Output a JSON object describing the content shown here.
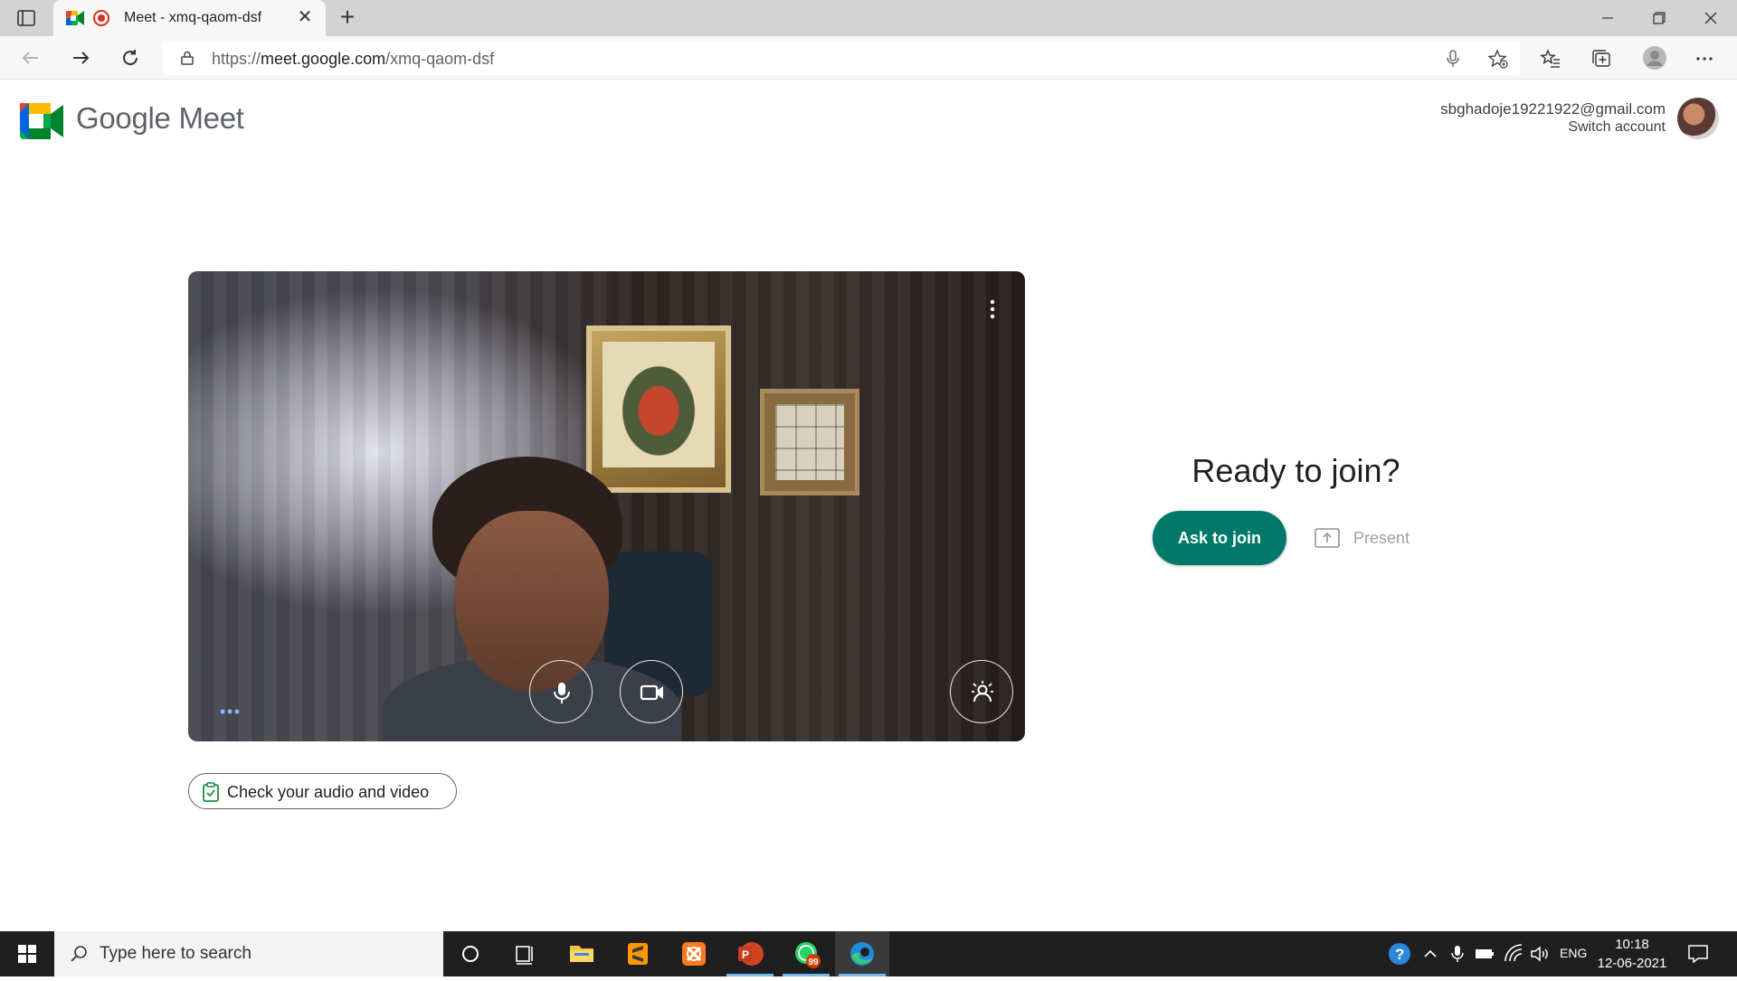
{
  "browser": {
    "tab_title": "Meet - xmq-qaom-dsf",
    "url_prefix": "https://",
    "url_host": "meet.google.com",
    "url_path": "/xmq-qaom-dsf"
  },
  "meet": {
    "brand": "Google Meet",
    "account_email": "sbghadoje19221922@gmail.com",
    "switch_account": "Switch account",
    "ready_heading": "Ready to join?",
    "ask_to_join": "Ask to join",
    "present": "Present",
    "check_audio_video": "Check your audio and video",
    "brand_colors": {
      "green": "#00832d",
      "blue": "#0066da",
      "red": "#e94235",
      "yellow": "#ffba00",
      "teal_button": "#00796b"
    }
  },
  "taskbar": {
    "search_placeholder": "Type here to search",
    "whatsapp_badge": "99",
    "language": "ENG",
    "time": "10:18",
    "date": "12-06-2021"
  },
  "icons": [
    "tab-actions-icon",
    "meet-favicon-icon",
    "recording-icon",
    "close-icon",
    "plus-icon",
    "minimize-icon",
    "restore-icon",
    "back-icon",
    "forward-icon",
    "refresh-icon",
    "lock-icon",
    "microphone-icon",
    "add-favorite-icon",
    "favorites-icon",
    "collections-icon",
    "profile-icon",
    "more-icon",
    "camera-icon",
    "visual-effects-icon",
    "checklist-icon",
    "present-icon",
    "windows-icon",
    "search-icon",
    "cortana-icon",
    "task-view-icon",
    "file-explorer-icon",
    "sublime-icon",
    "xampp-icon",
    "powerpoint-icon",
    "whatsapp-icon",
    "edge-icon",
    "help-icon",
    "chevron-up-icon",
    "battery-icon",
    "wifi-icon",
    "volume-icon",
    "notifications-icon"
  ]
}
